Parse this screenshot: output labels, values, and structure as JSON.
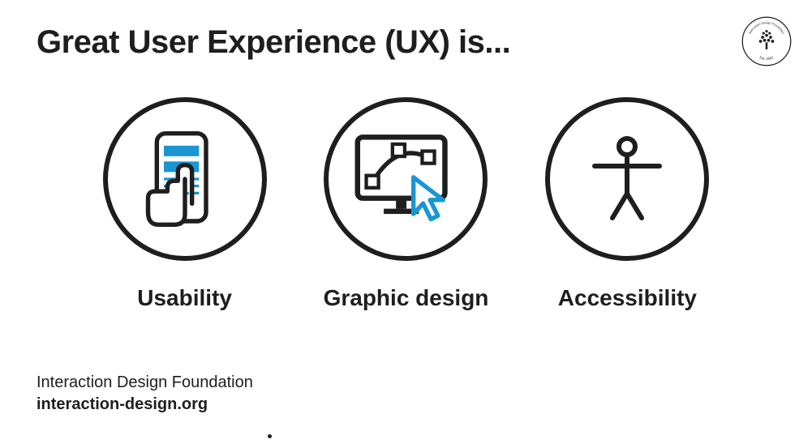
{
  "title": "Great User Experience (UX) is...",
  "logo": {
    "text_top": "Interaction Design Foundation",
    "text_bottom": "Est. 2002"
  },
  "items": [
    {
      "icon": "usability-icon",
      "label": "Usability"
    },
    {
      "icon": "graphic-design-icon",
      "label": "Graphic design"
    },
    {
      "icon": "accessibility-icon",
      "label": "Accessibility"
    }
  ],
  "footer": {
    "org": "Interaction Design Foundation",
    "url": "interaction-design.org"
  },
  "colors": {
    "accent": "#1996d3",
    "stroke": "#1e1e1e"
  }
}
